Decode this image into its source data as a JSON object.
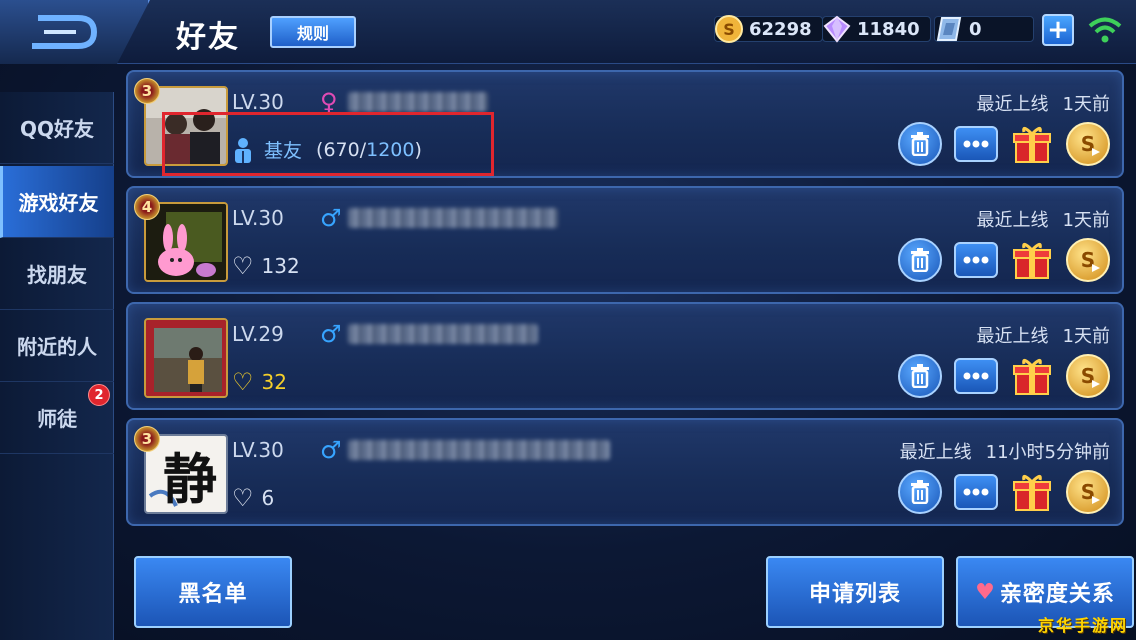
{
  "header": {
    "title": "好友",
    "rules_label": "规则",
    "currencies": [
      {
        "icon": "gold-coin-icon",
        "value": "62298"
      },
      {
        "icon": "diamond-icon",
        "value": "11840"
      },
      {
        "icon": "ticket-icon",
        "value": "0"
      }
    ],
    "add_label": "+"
  },
  "sidebar": {
    "items": [
      {
        "label": "QQ好友",
        "active": false
      },
      {
        "label": "游戏好友",
        "active": true
      },
      {
        "label": "找朋友",
        "active": false
      },
      {
        "label": "附近的人",
        "active": false
      },
      {
        "label": "师徒",
        "active": false,
        "badge": "2"
      }
    ]
  },
  "friends": [
    {
      "rank": "3",
      "level": "LV.30",
      "gender": "female",
      "relation": "基友",
      "relation_progress": "670",
      "relation_max": "1200",
      "online_label": "最近上线",
      "online_time": "1天前",
      "highlighted": true
    },
    {
      "rank": "4",
      "level": "LV.30",
      "gender": "male",
      "intimacy": "132",
      "heart": "white",
      "online_label": "最近上线",
      "online_time": "1天前"
    },
    {
      "rank": "",
      "level": "LV.29",
      "gender": "male",
      "intimacy": "32",
      "heart": "gold",
      "online_label": "最近上线",
      "online_time": "1天前"
    },
    {
      "rank": "3",
      "level": "LV.30",
      "gender": "male",
      "intimacy": "6",
      "heart": "white",
      "online_label": "最近上线",
      "online_time": "11小时5分钟前"
    }
  ],
  "avatar4_glyph": "静",
  "bottom": {
    "blacklist": "黑名单",
    "requests": "申请列表",
    "intimacy": "亲密度关系"
  },
  "watermark": "京华手游网",
  "colors": {
    "accent": "#3a88f2",
    "highlight_box": "#e0262e",
    "gold": "#f4cf2a"
  }
}
